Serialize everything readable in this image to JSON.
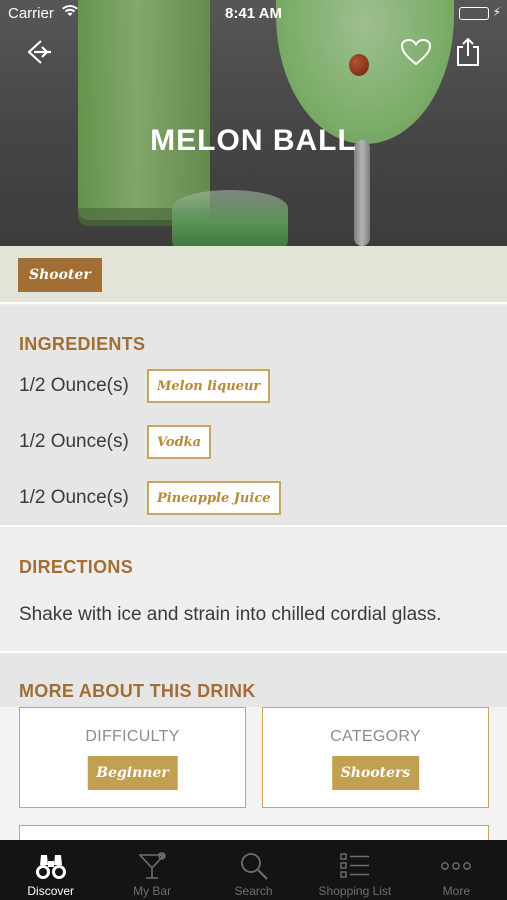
{
  "status_bar": {
    "carrier": "Carrier",
    "time": "8:41 AM",
    "battery_color": "#4cd964"
  },
  "header": {
    "title": "MELON BALL"
  },
  "icons": {
    "back": "back-icon",
    "favorite": "heart-icon",
    "share": "share-icon"
  },
  "tags": [
    "Shooter"
  ],
  "ingredients": {
    "title": "INGREDIENTS",
    "items": [
      {
        "quantity": "1/2 Ounce(s)",
        "name": "Melon liqueur"
      },
      {
        "quantity": "1/2 Ounce(s)",
        "name": "Vodka"
      },
      {
        "quantity": "1/2 Ounce(s)",
        "name": "Pineapple Juice"
      }
    ]
  },
  "directions": {
    "title": "DIRECTIONS",
    "text": "Shake with ice and strain into chilled cordial glass."
  },
  "more": {
    "title": "MORE ABOUT THIS DRINK",
    "difficulty": {
      "label": "DIFFICULTY",
      "value": "Beginner"
    },
    "category": {
      "label": "CATEGORY",
      "value": "Shooters"
    }
  },
  "tabbar": {
    "items": [
      {
        "label": "Discover",
        "icon": "binoculars-icon",
        "active": true
      },
      {
        "label": "My Bar",
        "icon": "cocktail-icon",
        "active": false
      },
      {
        "label": "Search",
        "icon": "search-icon",
        "active": false
      },
      {
        "label": "Shopping List",
        "icon": "list-icon",
        "active": false
      },
      {
        "label": "More",
        "icon": "more-icon",
        "active": false
      }
    ]
  },
  "colors": {
    "accent": "#a36e33",
    "gold": "#c9a75a",
    "tabbar_bg": "#141414"
  }
}
